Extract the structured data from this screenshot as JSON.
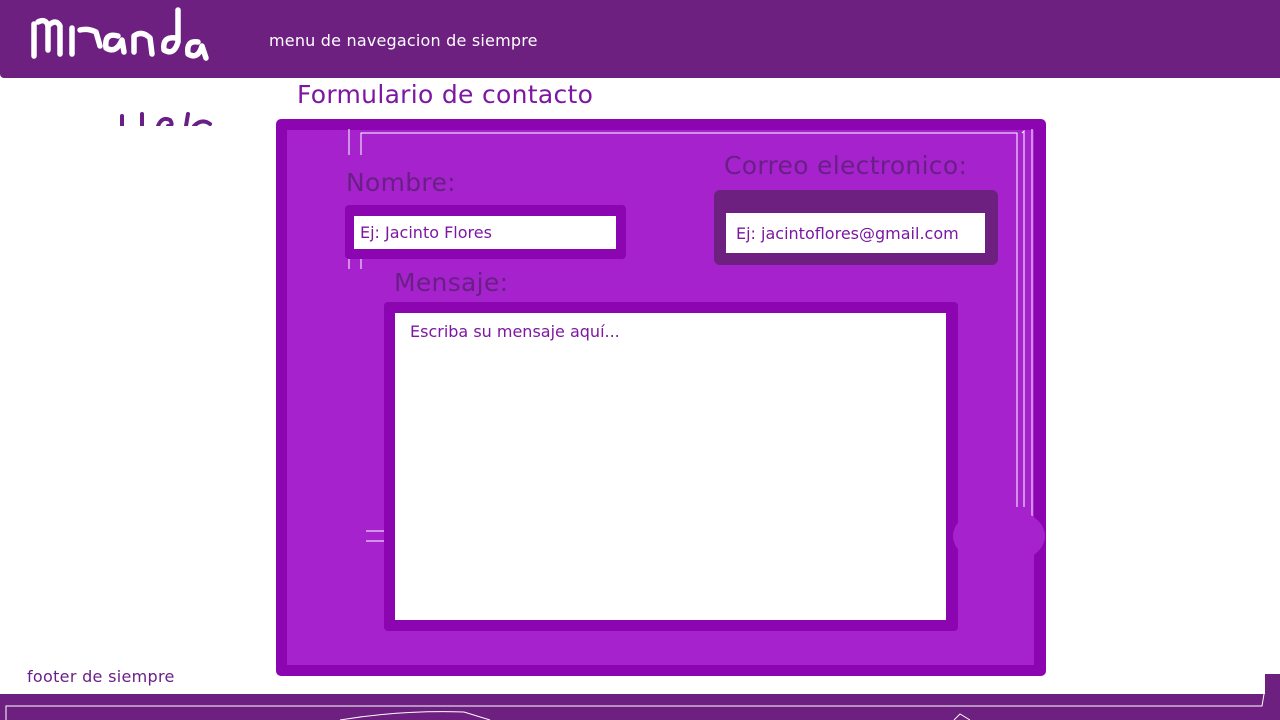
{
  "app": {
    "logo_text": "Miranda"
  },
  "header": {
    "nav_text": "menu de navegacion de siempre"
  },
  "main": {
    "title": "Formulario de contacto"
  },
  "form": {
    "nombre": {
      "label": "Nombre:",
      "placeholder": "Ej: Jacinto Flores",
      "value": ""
    },
    "correo": {
      "label": "Correo electronico:",
      "placeholder": "Ej: jacintoflores@gmail.com",
      "value": ""
    },
    "mensaje": {
      "label": "Mensaje:",
      "placeholder": "Escriba su mensaje aquí...",
      "value": ""
    }
  },
  "footer": {
    "text": "footer de siempre"
  },
  "colors": {
    "header_bg": "#6d2080",
    "panel_border": "#8b06b0",
    "panel_fill": "#a622cc",
    "title_text": "#7d17a2",
    "label_text": "#6a1f86"
  }
}
